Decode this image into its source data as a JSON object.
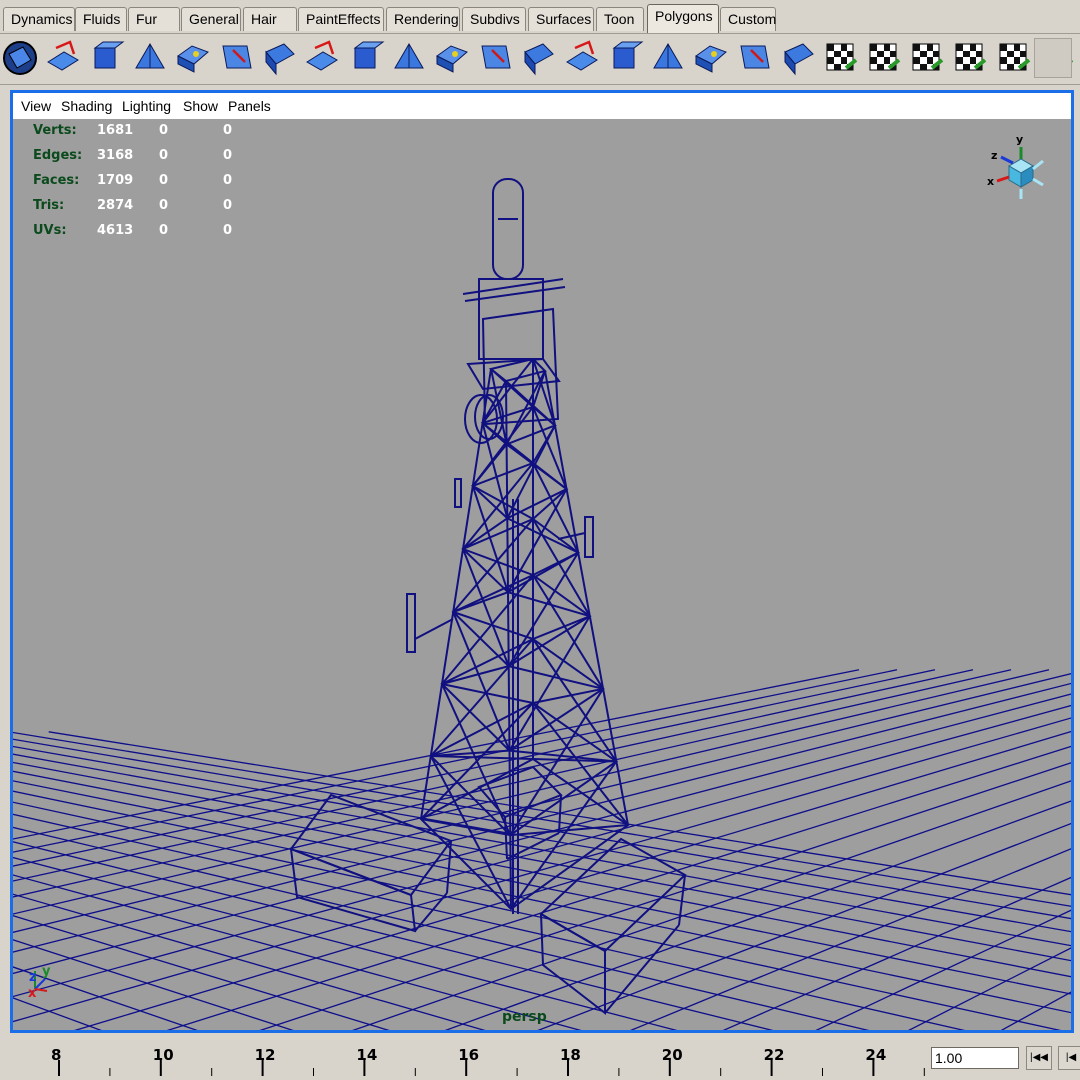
{
  "shelf_tabs": [
    {
      "label": "Dynamics",
      "active": false
    },
    {
      "label": "Fluids",
      "active": false
    },
    {
      "label": "Fur",
      "active": false
    },
    {
      "label": "General",
      "active": false
    },
    {
      "label": "Hair",
      "active": false
    },
    {
      "label": "PaintEffects",
      "active": false
    },
    {
      "label": "Rendering",
      "active": false
    },
    {
      "label": "Subdivs",
      "active": false
    },
    {
      "label": "Surfaces",
      "active": false
    },
    {
      "label": "Toon",
      "active": false
    },
    {
      "label": "Polygons",
      "active": true
    },
    {
      "label": "Custom",
      "active": false
    }
  ],
  "shelf_icons": [
    "polygon-sphere-icon",
    "combine-icon",
    "separate-icon",
    "smooth-icon",
    "subdivide-icon",
    "split-polygon-icon",
    "split-edge-icon",
    "extrude-face-icon",
    "extrude-edge-icon",
    "bevel-icon",
    "wedge-face-icon",
    "poke-face-icon",
    "merge-vertices-icon",
    "merge-edges-icon",
    "collapse-icon",
    "duplicate-face-icon",
    "extract-icon",
    "transfer-icon",
    "sculpt-icon",
    "planar-map-icon",
    "automatic-map-icon",
    "cylindrical-map-icon",
    "spherical-map-icon",
    "uv-editor-icon",
    "texture-view-icon",
    "blank-shelf-slot"
  ],
  "viewport": {
    "menus": [
      "View",
      "Shading",
      "Lighting",
      "Show",
      "Panels"
    ],
    "camera_label": "persp",
    "stats": [
      {
        "label": "Verts:",
        "values": [
          "1681",
          "0",
          "0"
        ]
      },
      {
        "label": "Edges:",
        "values": [
          "3168",
          "0",
          "0"
        ]
      },
      {
        "label": "Faces:",
        "values": [
          "1709",
          "0",
          "0"
        ]
      },
      {
        "label": "Tris:",
        "values": [
          "2874",
          "0",
          "0"
        ]
      },
      {
        "label": "UVs:",
        "values": [
          "4613",
          "0",
          "0"
        ]
      }
    ],
    "view_cube_axes": [
      "y",
      "z",
      "x"
    ],
    "origin_axes": [
      "z",
      "y",
      "x"
    ]
  },
  "timeline": {
    "ticks": [
      "8",
      "10",
      "12",
      "14",
      "16",
      "18",
      "20",
      "22",
      "24"
    ],
    "current_time": "1.00"
  },
  "colors": {
    "viewport_bg": "#9e9e9e",
    "grid": "#0e0e8a",
    "wire": "#101080",
    "active_border": "#1a6ee8",
    "hud_label": "#0b4a1c"
  }
}
